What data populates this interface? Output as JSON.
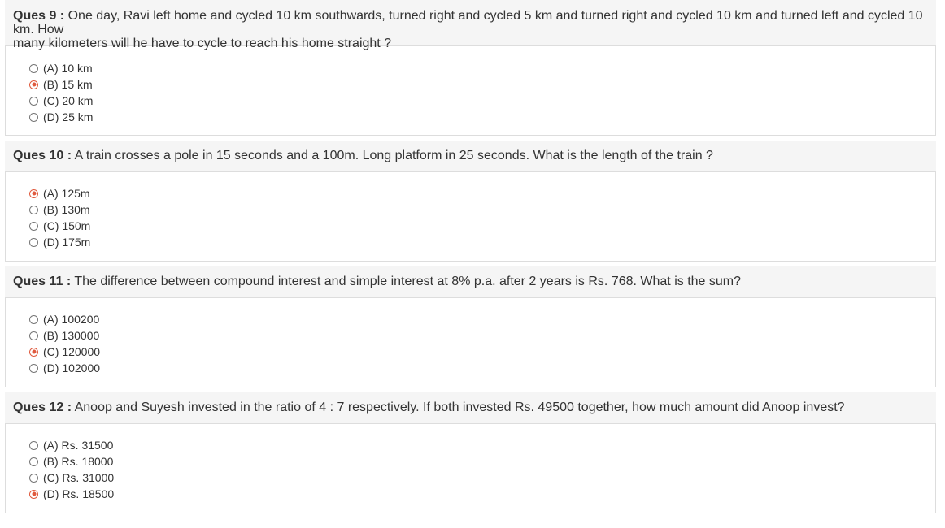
{
  "accent_color": "#e05a3e",
  "questions": [
    {
      "number_label": "Ques 9 :",
      "text_line1": "One day, Ravi left home and cycled 10 km southwards, turned right and cycled 5 km and turned right and cycled 10 km and turned left and cycled 10 km. How",
      "text_line2": "many kilometers will he have to cycle to reach his home straight ?",
      "options": [
        {
          "label": "(A) 10 km",
          "selected": false
        },
        {
          "label": "(B) 15 km",
          "selected": true
        },
        {
          "label": "(C) 20 km",
          "selected": false
        },
        {
          "label": "(D) 25 km",
          "selected": false
        }
      ]
    },
    {
      "number_label": "Ques 10 :",
      "text_line1": "A train crosses a pole in 15 seconds and a 100m. Long platform in 25 seconds. What is the length of the train ?",
      "options": [
        {
          "label": "(A) 125m",
          "selected": true
        },
        {
          "label": "(B) 130m",
          "selected": false
        },
        {
          "label": "(C) 150m",
          "selected": false
        },
        {
          "label": "(D) 175m",
          "selected": false
        }
      ]
    },
    {
      "number_label": "Ques 11 :",
      "text_line1": "The difference between compound interest and simple interest at 8% p.a. after 2 years is Rs. 768. What is the sum?",
      "options": [
        {
          "label": "(A) 100200",
          "selected": false
        },
        {
          "label": "(B) 130000",
          "selected": false
        },
        {
          "label": "(C) 120000",
          "selected": true
        },
        {
          "label": "(D) 102000",
          "selected": false
        }
      ]
    },
    {
      "number_label": "Ques 12 :",
      "text_line1": "Anoop and Suyesh invested in the ratio of 4 : 7 respectively. If both invested Rs. 49500 together, how much amount did Anoop invest?",
      "options": [
        {
          "label": "(A) Rs. 31500",
          "selected": false
        },
        {
          "label": "(B) Rs. 18000",
          "selected": false
        },
        {
          "label": "(C) Rs. 31000",
          "selected": false
        },
        {
          "label": "(D) Rs. 18500",
          "selected": true
        }
      ]
    }
  ]
}
